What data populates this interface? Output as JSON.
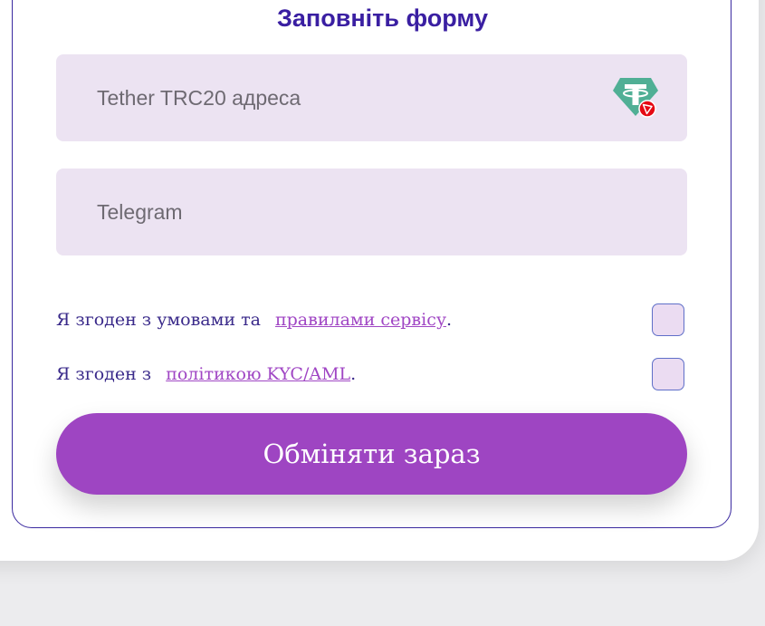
{
  "form": {
    "title": "Заповніть форму",
    "wallet_placeholder": "Tether TRC20 адреса",
    "wallet_icon": "usdt-trc20-icon",
    "telegram_placeholder": "Telegram",
    "terms_text": "Я згоден з умовами та",
    "terms_link": "правилами сервісу",
    "terms_end": ".",
    "kyc_text": "Я згоден з",
    "kyc_link": "політикою KYC/AML",
    "kyc_end": ".",
    "submit_label": "Обміняти зараз"
  },
  "colors": {
    "title": "#3a1fa2",
    "field_bg": "#ece3f2",
    "link": "#a046c4",
    "button": "#9e45c2",
    "tether_green": "#50af95",
    "tron_red": "#e50914"
  }
}
